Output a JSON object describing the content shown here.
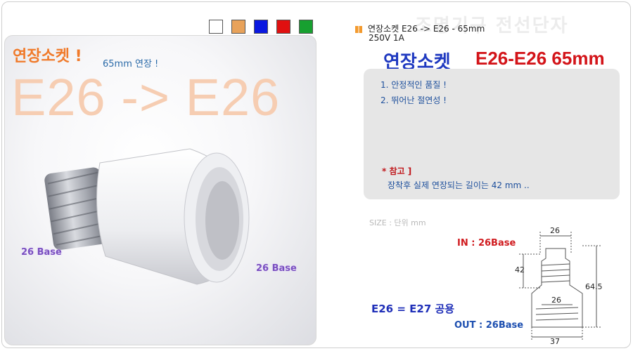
{
  "left": {
    "color_swatches": [
      "#ffffff",
      "#e8a25a",
      "#0a18e0",
      "#e01010",
      "#17a030"
    ],
    "promo_title": "연장소켓 !",
    "promo_sub": "65mm 연장 !",
    "big_text": "E26 -> E26",
    "base_label_left": "26 Base",
    "base_label_right": "26 Base"
  },
  "right": {
    "watermark": "조명기구 전선단자",
    "title": "연장소켓 E26 -> E26 - 65mm",
    "spec": "250V 1A",
    "heading_ko": "연장소켓",
    "heading_en": "E26-E26 65mm",
    "features": [
      "1. 안정적인 품질 !",
      "2. 뛰어난 절연성 !"
    ],
    "note_title": "* 참고 ]",
    "note_text": "장착후 실제 연장되는 길이는 42 mm ..",
    "size_label": "SIZE : 단위 mm",
    "in_label": "IN : 26Base",
    "out_label": "OUT : 26Base",
    "compat": "E26 = E27 공용"
  },
  "diagram": {
    "top_width": "26",
    "height_left": "42",
    "height_total": "64.5",
    "inner_width": "26",
    "bottom_width": "37"
  }
}
